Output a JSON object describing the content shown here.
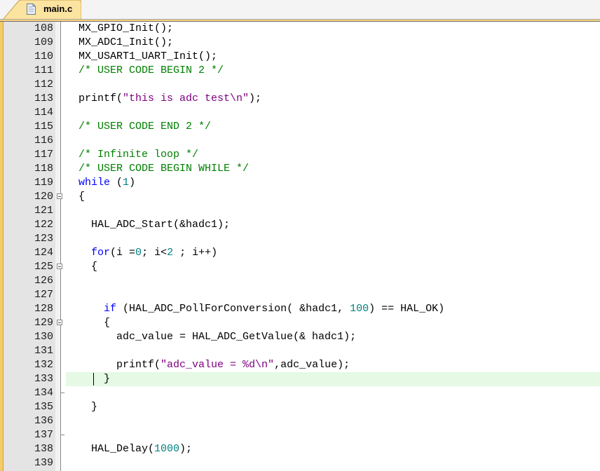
{
  "tab": {
    "filename": "main.c",
    "icon": "c-file-icon"
  },
  "editor": {
    "highlighted_line": 133,
    "lines": [
      {
        "n": "108",
        "tokens": [
          {
            "t": "  MX_GPIO_Init();",
            "c": ""
          }
        ]
      },
      {
        "n": "109",
        "tokens": [
          {
            "t": "  MX_ADC1_Init();",
            "c": ""
          }
        ]
      },
      {
        "n": "110",
        "tokens": [
          {
            "t": "  MX_USART1_UART_Init();",
            "c": ""
          }
        ]
      },
      {
        "n": "111",
        "tokens": [
          {
            "t": "  ",
            "c": ""
          },
          {
            "t": "/* USER CODE BEGIN 2 */",
            "c": "cm"
          }
        ]
      },
      {
        "n": "112",
        "tokens": []
      },
      {
        "n": "113",
        "tokens": [
          {
            "t": "  printf(",
            "c": ""
          },
          {
            "t": "\"this is adc test\\n\"",
            "c": "st"
          },
          {
            "t": ");",
            "c": ""
          }
        ]
      },
      {
        "n": "114",
        "tokens": []
      },
      {
        "n": "115",
        "tokens": [
          {
            "t": "  ",
            "c": ""
          },
          {
            "t": "/* USER CODE END 2 */",
            "c": "cm"
          }
        ]
      },
      {
        "n": "116",
        "tokens": []
      },
      {
        "n": "117",
        "tokens": [
          {
            "t": "  ",
            "c": ""
          },
          {
            "t": "/* Infinite loop */",
            "c": "cm"
          }
        ]
      },
      {
        "n": "118",
        "tokens": [
          {
            "t": "  ",
            "c": ""
          },
          {
            "t": "/* USER CODE BEGIN WHILE */",
            "c": "cm"
          }
        ]
      },
      {
        "n": "119",
        "tokens": [
          {
            "t": "  ",
            "c": ""
          },
          {
            "t": "while",
            "c": "kw"
          },
          {
            "t": " (",
            "c": ""
          },
          {
            "t": "1",
            "c": "nm"
          },
          {
            "t": ")",
            "c": ""
          }
        ]
      },
      {
        "n": "120",
        "fold": "open",
        "tokens": [
          {
            "t": "  {",
            "c": ""
          }
        ]
      },
      {
        "n": "121",
        "tokens": []
      },
      {
        "n": "122",
        "tokens": [
          {
            "t": "    HAL_ADC_Start(&hadc1);",
            "c": ""
          }
        ]
      },
      {
        "n": "123",
        "tokens": []
      },
      {
        "n": "124",
        "tokens": [
          {
            "t": "    ",
            "c": ""
          },
          {
            "t": "for",
            "c": "kw"
          },
          {
            "t": "(i =",
            "c": ""
          },
          {
            "t": "0",
            "c": "nm"
          },
          {
            "t": "; i<",
            "c": ""
          },
          {
            "t": "2",
            "c": "nm"
          },
          {
            "t": " ; i++)",
            "c": ""
          }
        ]
      },
      {
        "n": "125",
        "fold": "open",
        "tokens": [
          {
            "t": "    {",
            "c": ""
          }
        ]
      },
      {
        "n": "126",
        "tokens": []
      },
      {
        "n": "127",
        "tokens": []
      },
      {
        "n": "128",
        "tokens": [
          {
            "t": "      ",
            "c": ""
          },
          {
            "t": "if",
            "c": "kw"
          },
          {
            "t": " (HAL_ADC_PollForConversion( &hadc1, ",
            "c": ""
          },
          {
            "t": "100",
            "c": "nm"
          },
          {
            "t": ") == HAL_OK)",
            "c": ""
          }
        ]
      },
      {
        "n": "129",
        "fold": "open",
        "tokens": [
          {
            "t": "      {",
            "c": ""
          }
        ]
      },
      {
        "n": "130",
        "tokens": [
          {
            "t": "        adc_value = HAL_ADC_GetValue(& hadc1);",
            "c": ""
          }
        ]
      },
      {
        "n": "131",
        "tokens": []
      },
      {
        "n": "132",
        "tokens": [
          {
            "t": "        printf(",
            "c": ""
          },
          {
            "t": "\"adc_value = %d\\n\"",
            "c": "st"
          },
          {
            "t": ",adc_value);",
            "c": ""
          }
        ]
      },
      {
        "n": "133",
        "tokens": [
          {
            "t": "      }",
            "c": ""
          }
        ]
      },
      {
        "n": "134",
        "fold": "end",
        "tokens": []
      },
      {
        "n": "135",
        "tokens": [
          {
            "t": "    }",
            "c": ""
          }
        ]
      },
      {
        "n": "136",
        "tokens": []
      },
      {
        "n": "137",
        "fold": "end",
        "tokens": []
      },
      {
        "n": "138",
        "tokens": [
          {
            "t": "    HAL_Delay(",
            "c": ""
          },
          {
            "t": "1000",
            "c": "nm"
          },
          {
            "t": ");",
            "c": ""
          }
        ]
      },
      {
        "n": "139",
        "tokens": []
      }
    ]
  }
}
